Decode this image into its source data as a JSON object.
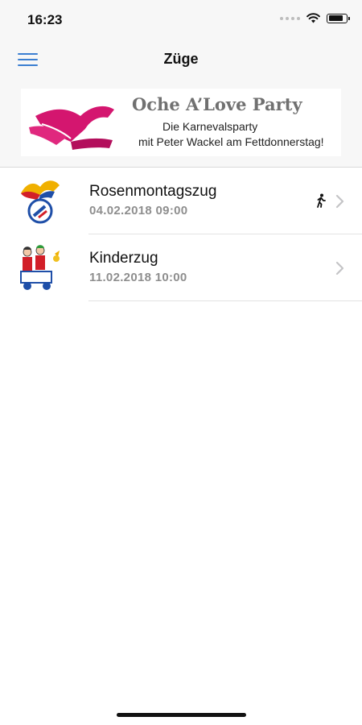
{
  "status_bar": {
    "time": "16:23",
    "battery_level": 0.85
  },
  "nav": {
    "title": "Züge",
    "menu_icon": "hamburger-menu-icon"
  },
  "banner": {
    "title": "Oche A’Love Party",
    "line1": "Die Karnevalsparty",
    "line2": "mit Peter Wackel am Fettdonnerstag!",
    "logo_color": "#d4166f"
  },
  "trains": [
    {
      "name": "Rosenmontagszug",
      "datetime": "04.02.2018 09:00",
      "icon": "jester-cap-emblem-icon",
      "status_icon": "walking-person-icon"
    },
    {
      "name": "Kinderzug",
      "datetime": "11.02.2018 10:00",
      "icon": "children-carnival-icon"
    }
  ],
  "colors": {
    "accent": "#3b7fd1",
    "header_bg": "#f7f7f7",
    "subtitle": "#8e8e8e"
  }
}
